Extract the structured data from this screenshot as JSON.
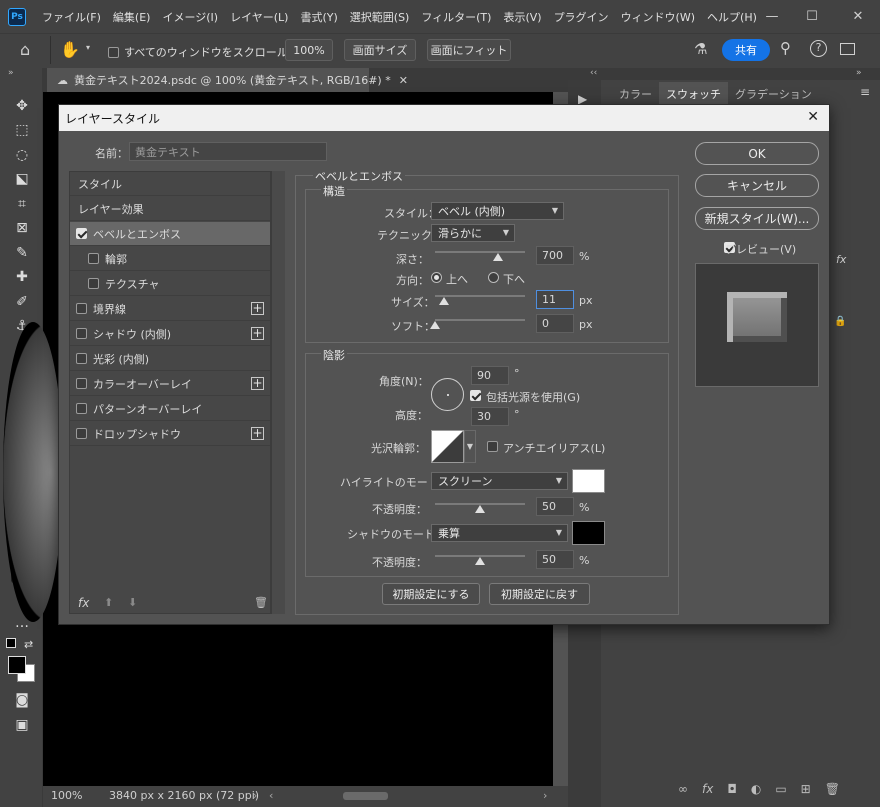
{
  "menu": [
    "ファイル(F)",
    "編集(E)",
    "イメージ(I)",
    "レイヤー(L)",
    "書式(Y)",
    "選択範囲(S)",
    "フィルター(T)",
    "表示(V)",
    "プラグイン",
    "ウィンドウ(W)",
    "ヘルプ(H)"
  ],
  "app_logo": "Ps",
  "options": {
    "scroll_all_label": "すべてのウィンドウをスクロール",
    "zoom_value": "100%",
    "screen_size": "画面サイズ",
    "fit_screen": "画面にフィット",
    "share": "共有"
  },
  "doc_tab": "黄金テキスト2024.psdc @ 100% (黄金テキスト, RGB/16#) *",
  "status": {
    "zoom": "100%",
    "doc_size": "3840 px x 2160 px (72 ppi)"
  },
  "right_panel": {
    "tabs": [
      "カラー",
      "スウォッチ",
      "グラデーション"
    ],
    "fx_label": "fx"
  },
  "dialog": {
    "title": "レイヤースタイル",
    "name_label": "名前：",
    "name_value": "黄金テキスト",
    "style_items": [
      {
        "label": "スタイル"
      },
      {
        "label": "レイヤー効果"
      },
      {
        "label": "ベベルとエンボス",
        "checked": true
      },
      {
        "label": "輪郭"
      },
      {
        "label": "テクスチャ"
      },
      {
        "label": "境界線"
      },
      {
        "label": "シャドウ (内側)"
      },
      {
        "label": "光彩 (内側)"
      },
      {
        "label": "カラーオーバーレイ"
      },
      {
        "label": "パターンオーバーレイ"
      },
      {
        "label": "ドロップシャドウ"
      }
    ],
    "section_title": "ベベルとエンボス",
    "structure": {
      "title": "構造",
      "style_label": "スタイル：",
      "style_value": "ベベル (内側)",
      "technique_label": "テクニック：",
      "technique_value": "滑らかに",
      "depth_label": "深さ：",
      "depth_value": "700",
      "depth_unit": "%",
      "depth_level": 0.7,
      "direction_label": "方向：",
      "direction_up": "上へ",
      "direction_down": "下へ",
      "direction_selected": "上へ",
      "size_label": "サイズ：",
      "size_value": "11",
      "size_unit": "px",
      "size_level": 0.1,
      "soften_label": "ソフト：",
      "soften_value": "0",
      "soften_unit": "px",
      "soften_level": 0
    },
    "shading": {
      "title": "陰影",
      "angle_label": "角度(N)：",
      "angle_value": "90",
      "angle_unit": "°",
      "global_light_label": "包括光源を使用(G)",
      "global_light_checked": true,
      "altitude_label": "高度：",
      "altitude_value": "30",
      "altitude_unit": "°",
      "gloss_label": "光沢輪郭：",
      "antialias_label": "アンチエイリアス(L)",
      "antialias_checked": false,
      "highlight_label": "ハイライトのモード：",
      "highlight_mode": "スクリーン",
      "highlight_color": "#ffffff",
      "highlight_opacity_label": "不透明度：",
      "highlight_opacity": "50",
      "highlight_opacity_unit": "%",
      "highlight_opacity_level": 0.5,
      "shadow_label": "シャドウのモード：",
      "shadow_mode": "乗算",
      "shadow_color": "#000000",
      "shadow_opacity_label": "不透明度：",
      "shadow_opacity": "50",
      "shadow_opacity_unit": "%",
      "shadow_opacity_level": 0.5
    },
    "make_default": "初期設定にする",
    "reset_default": "初期設定に戻す",
    "ok": "OK",
    "cancel": "キャンセル",
    "new_style": "新規スタイル(W)...",
    "preview_label": "プレビュー(V)",
    "preview_checked": true,
    "fx_label": "fx"
  }
}
